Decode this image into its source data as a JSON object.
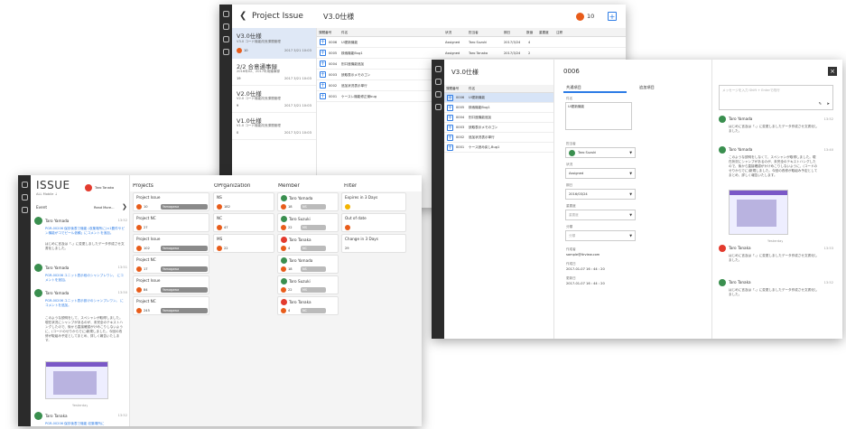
{
  "brand": {
    "blue": "#2c7be5",
    "orange": "#e85c1a",
    "green": "#3a8f4f",
    "yellow": "#f3b400",
    "dark": "#2b2b2b"
  },
  "back": {
    "title": "Project Issue",
    "list_title": "V3.0仕様",
    "badge_count": "10",
    "columns": [
      "課題番号",
      "件名",
      "状況",
      "担当者",
      "期日",
      "数値",
      "重要度",
      "注釈"
    ],
    "rows": [
      {
        "id": "0006",
        "name": "UI更新機能",
        "status": "Assigned",
        "person": "Taro Suzuki",
        "date": "2017/3/24",
        "n": "4"
      },
      {
        "id": "0005",
        "name": "検索機能Bug1",
        "status": "Assigned",
        "person": "Taro Tanaka",
        "date": "2017/3/24",
        "n": "2"
      },
      {
        "id": "0004",
        "name": "別口座機能追加",
        "status": "",
        "person": "",
        "date": "",
        "n": ""
      },
      {
        "id": "0003",
        "name": "読取表示メモのゴン",
        "status": "",
        "person": "",
        "date": "",
        "n": ""
      },
      {
        "id": "0002",
        "name": "追加状況表示単行",
        "status": "",
        "person": "",
        "date": "",
        "n": ""
      },
      {
        "id": "0001",
        "name": "ケースレ機能修正案bug",
        "status": "",
        "person": "",
        "date": "",
        "n": ""
      }
    ],
    "projects": [
      {
        "title": "V3.0仕様",
        "desc": "V3.0 コード機能改良課題管理",
        "count": "10",
        "date": "2017 3/21 10:03"
      },
      {
        "title": "2/2 合意通事録",
        "desc": "2016年02、2017年用議事録",
        "count": "19",
        "date": "2017 3/21 10:03"
      },
      {
        "title": "V2.0仕様",
        "desc": "V2.0 コード機能改良課題管理",
        "count": "9",
        "date": "2017 3/21 10:03"
      },
      {
        "title": "V1.0仕様",
        "desc": "V1.0 コード機能改良課題管理",
        "count": "0",
        "date": "2017 3/21 10:03"
      }
    ]
  },
  "mid": {
    "list_title": "V3.0仕様",
    "col_id": "課題番号",
    "col_name": "件名",
    "rows": [
      {
        "id": "0006",
        "name": "UI更新機能"
      },
      {
        "id": "0005",
        "name": "検索機能Bug1"
      },
      {
        "id": "0004",
        "name": "別口座機能追加"
      },
      {
        "id": "0003",
        "name": "読取表示メモのゴン"
      },
      {
        "id": "0002",
        "name": "追加状況表示単行"
      },
      {
        "id": "0001",
        "name": "ケース読み戻しBug1"
      }
    ],
    "detail": {
      "id": "0006",
      "tab_basic": "共通項目",
      "tab_extra": "追加項目",
      "subject_label": "件名",
      "subject_value": "UI更新機能",
      "assignee_label": "担当者",
      "assignee": "Taro Suzuki",
      "status_label": "状況",
      "status": "Assigned",
      "due_label": "期日",
      "due": "2016/03/24",
      "priority_label": "重要度",
      "priority": "重要度",
      "category_label": "分類",
      "category": "分類",
      "meta1_label": "作成者",
      "meta1": "sample@itrview.com",
      "meta2_label": "作成日",
      "meta2": "2017-01-07 16 : 44 : 20",
      "meta3_label": "更新日",
      "meta3": "2017-01-07 16 : 44 : 20"
    },
    "chat": {
      "placeholder": "メッセージを入力 Shift + Enterで改行",
      "messages": [
        {
          "user": "Taro Yamada",
          "time": "13:52",
          "text": "はじめに言及は「-」に変更しましたデータ作成させ文書化しました。"
        },
        {
          "user": "Taro Yamada",
          "time": "13:40",
          "text": "このような説明をしなくて、スペシャンが取得しました。現在状況にシャンプがあるのが、未完全のテキストハングしたので、後から直接確認がかけめこりしないように、(コードのせりからでに)新規しました。今回の改修が取組み予定としてまとめ、詳しく報告いたします。"
        },
        {
          "user": "Taro Tanaka",
          "time": "13:53",
          "text": "はじめに言及は「-」に変更しましたデータ作成させ文書化しました。"
        },
        {
          "user": "Taro Tanaka",
          "time": "13:52",
          "text": "はじめに言及は「-」に変更しましたデータ作成させ文書化しました。"
        }
      ],
      "divider": "Yesterday"
    }
  },
  "front": {
    "logo": "ISSUE",
    "logo_sub": "ALL Mobile ↓",
    "user": "Taro Tanaka",
    "event_title": "Event",
    "read_more": "Read More...",
    "events": [
      {
        "user": "Taro Yamada",
        "time": "13:52",
        "link": "PGR-00206 保存後表で機能 (収集場所に)×1要件やピン機能がコでピール依頼」にコメントを追加。",
        "text": "はじめに言及は「-」に変更しましたデータ作成させ文書化しました。"
      },
      {
        "user": "Taro Yamada",
        "time": "13:51",
        "link": "PGR-00206 ユニット表示段のシャンプレワン。 にコメントを追加。",
        "text": ""
      },
      {
        "user": "Taro Yamada",
        "time": "13:50",
        "link": "PGR-00206 ユニット表示設けのシャンプレワン。 にコメントを追加。",
        "text": "このような説明をして、スペシャンが取得しました。現在状況にシャンプがあるのが、未完全のテキストハングしたので、後から直接確認がけめこりしないように、(コードのせりからでに)新規しました。今回の改修が取組み予定としてまとめ、詳しく報告いたします。"
      },
      {
        "user": "Taro Tanaka",
        "time": "13:52",
        "link": "PGR-00206 保存後表で機能 収集場所に",
        "text": ""
      }
    ],
    "divider": "Yesterday",
    "col_projects": "Projects",
    "col_org": "OPrganization",
    "col_member": "Member",
    "col_filter": "Filter",
    "projects": [
      {
        "name": "Project Issue",
        "count": "10",
        "tag": "Yamagawa"
      },
      {
        "name": "Project NC",
        "count": "27",
        "tag": ""
      },
      {
        "name": "Project Issue",
        "count": "102",
        "tag": "Yamagawa"
      },
      {
        "name": "Project NC",
        "count": "17",
        "tag": "Yamagawa"
      },
      {
        "name": "Project Issue",
        "count": "84",
        "tag": "Yamagawa"
      },
      {
        "name": "Project NC",
        "count": "245",
        "tag": "Yamagawa"
      }
    ],
    "orgs": [
      {
        "name": "NS",
        "count": "182"
      },
      {
        "name": "NC",
        "count": "47"
      },
      {
        "name": "MS",
        "count": "22"
      }
    ],
    "members": [
      {
        "name": "Taro Yamada",
        "count": "18",
        "tag": "NS"
      },
      {
        "name": "Taro Suzuki",
        "count": "22",
        "tag": "MS"
      },
      {
        "name": "Taro Tanaka",
        "count": "4",
        "tag": "NC"
      },
      {
        "name": "Taro Yamada",
        "count": "18",
        "tag": "NS"
      },
      {
        "name": "Taro Suzuki",
        "count": "22",
        "tag": "MS"
      },
      {
        "name": "Taro Tanaka",
        "count": "4",
        "tag": "NC"
      }
    ],
    "filters": [
      {
        "name": "Expires in 3 Days",
        "value": ""
      },
      {
        "name": "Out of date",
        "value": ""
      },
      {
        "name": "Change in 3 Days",
        "value": "29"
      }
    ]
  }
}
